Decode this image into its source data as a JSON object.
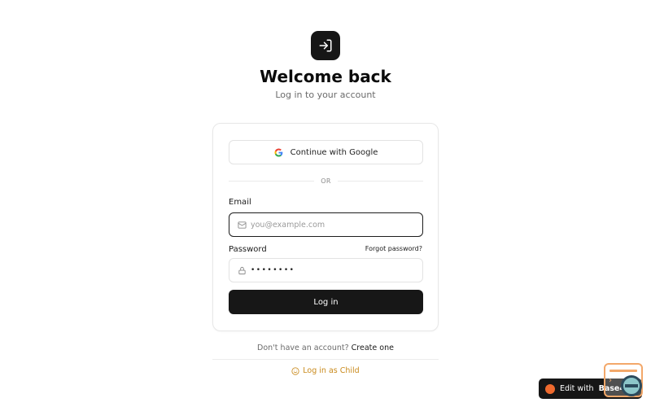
{
  "header": {
    "title": "Welcome back",
    "subtitle": "Log in to your account"
  },
  "auth": {
    "google_label": "Continue with Google",
    "divider_label": "OR",
    "email_label": "Email",
    "email_placeholder": "you@example.com",
    "password_label": "Password",
    "forgot_label": "Forgot password?",
    "password_value": "••••••••",
    "submit_label": "Log in"
  },
  "footer": {
    "signup_prompt": "Don't have an account?",
    "signup_link": "Create one",
    "child_label": "Log in as Child"
  },
  "badge": {
    "prefix": "Edit with",
    "brand": "Base44"
  },
  "colors": {
    "primary": "#171717",
    "accent_child": "#c98a1c",
    "badge_dot": "#ef6a2e"
  },
  "icons": {
    "app": "log-in-icon",
    "google": "google-icon",
    "email": "mail-icon",
    "password": "lock-icon",
    "child": "smile-icon"
  }
}
